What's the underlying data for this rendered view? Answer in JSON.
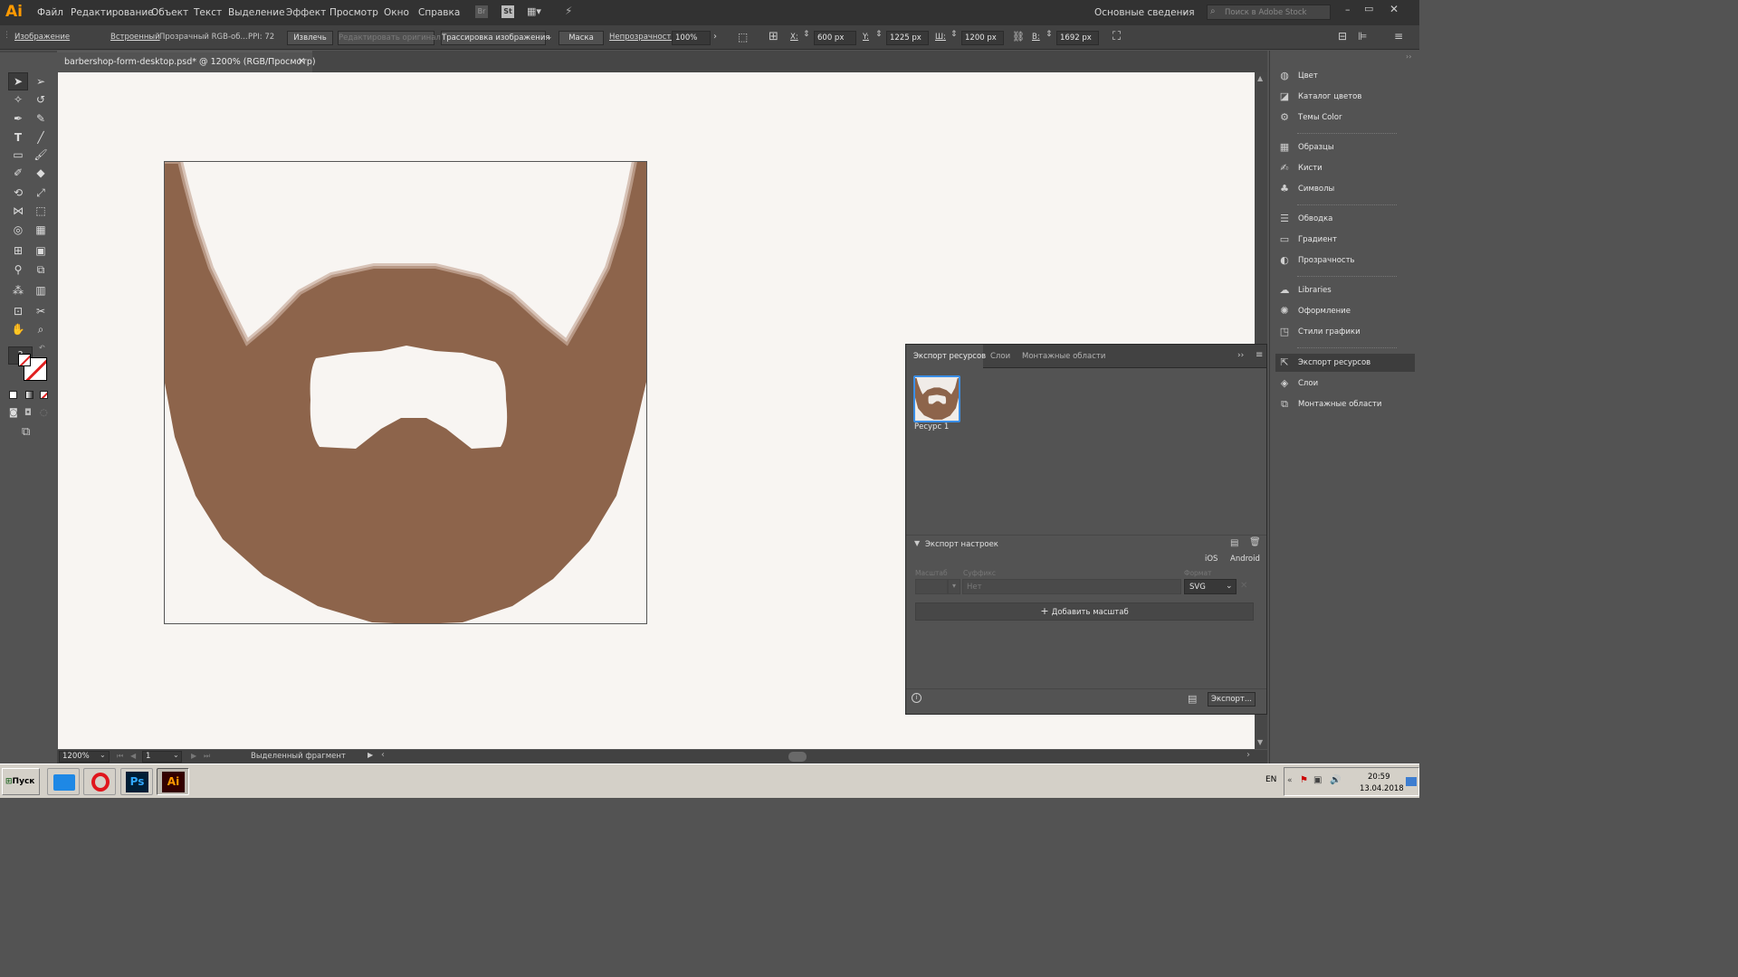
{
  "app": {
    "logo": "Ai"
  },
  "menu": [
    "Файл",
    "Редактирование",
    "Объект",
    "Текст",
    "Выделение",
    "Эффект",
    "Просмотр",
    "Окно",
    "Справка"
  ],
  "menubar_right": {
    "workspace": "Основные сведения",
    "search_placeholder": "Поиск в Adobe Stock",
    "br": "Br",
    "st": "St"
  },
  "control": {
    "image_label": "Изображение",
    "embedded": "Встроенный",
    "color_info": "Прозрачный RGB-об...",
    "ppi": "PPI: 72",
    "extract_button": "Извлечь",
    "edit_original_button": "Редактировать оригинал",
    "trace_button": "Трассировка изображения",
    "mask_button": "Маска",
    "opacity_label": "Непрозрачность:",
    "opacity_value": "100%",
    "x_label": "X:",
    "x_value": "600 px",
    "y_label": "Y:",
    "y_value": "1225 px",
    "w_label": "Ш:",
    "w_value": "1200 px",
    "h_label": "В:",
    "h_value": "1692 px"
  },
  "document": {
    "tab_title": "barbershop-form-desktop.psd* @ 1200% (RGB/Просмотр)",
    "close": "×"
  },
  "status": {
    "zoom": "1200%",
    "artboard": "1",
    "info": "Выделенный фрагмент"
  },
  "right_panels": [
    {
      "label": "Цвет",
      "icon": "color-icon"
    },
    {
      "label": "Каталог цветов",
      "icon": "color-guide-icon"
    },
    {
      "label": "Темы Color",
      "icon": "color-themes-icon"
    },
    {
      "label": "Образцы",
      "icon": "swatches-icon"
    },
    {
      "label": "Кисти",
      "icon": "brushes-icon"
    },
    {
      "label": "Символы",
      "icon": "symbols-icon"
    },
    {
      "label": "Обводка",
      "icon": "stroke-icon"
    },
    {
      "label": "Градиент",
      "icon": "gradient-icon"
    },
    {
      "label": "Прозрачность",
      "icon": "transparency-icon"
    },
    {
      "label": "Libraries",
      "icon": "libraries-icon"
    },
    {
      "label": "Оформление",
      "icon": "appearance-icon"
    },
    {
      "label": "Стили графики",
      "icon": "graphic-styles-icon"
    },
    {
      "label": "Экспорт ресурсов",
      "icon": "asset-export-icon"
    },
    {
      "label": "Слои",
      "icon": "layers-icon"
    },
    {
      "label": "Монтажные области",
      "icon": "artboards-icon"
    }
  ],
  "export_panel": {
    "tabs": [
      "Экспорт ресурсов",
      "Слои",
      "Монтажные области"
    ],
    "asset_name": "Ресурс 1",
    "settings_title": "Экспорт настроек",
    "ios": "iOS",
    "android": "Android",
    "scale_label": "Масштаб",
    "suffix_label": "Суффикс",
    "format_label": "Формат",
    "suffix_placeholder": "Нет",
    "format_value": "SVG",
    "add_scale": "Добавить масштаб",
    "export_button": "Экспорт..."
  },
  "taskbar": {
    "start": "Пуск",
    "lang": "EN",
    "time": "20:59",
    "date": "13.04.2018"
  },
  "colors": {
    "beard": "#8d644b",
    "canvas": "#f8f5f2",
    "menubar": "#323232",
    "panel": "#535353",
    "accent": "#ff9a00"
  }
}
